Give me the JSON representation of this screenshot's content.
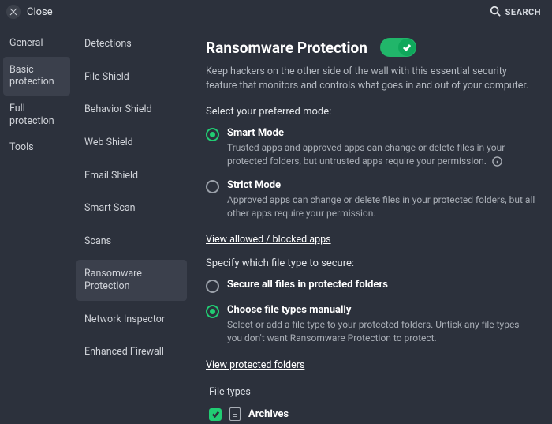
{
  "topbar": {
    "close_label": "Close",
    "search_label": "SEARCH"
  },
  "nav1": {
    "items": [
      {
        "label": "General"
      },
      {
        "label": "Basic protection"
      },
      {
        "label": "Full protection"
      },
      {
        "label": "Tools"
      }
    ],
    "active_index": 1
  },
  "nav2": {
    "items": [
      {
        "label": "Detections"
      },
      {
        "label": "File Shield"
      },
      {
        "label": "Behavior Shield"
      },
      {
        "label": "Web Shield"
      },
      {
        "label": "Email Shield"
      },
      {
        "label": "Smart Scan"
      },
      {
        "label": "Scans"
      },
      {
        "label": "Ransomware Protection"
      },
      {
        "label": "Network Inspector"
      },
      {
        "label": "Enhanced Firewall"
      }
    ],
    "active_index": 7
  },
  "main": {
    "title": "Ransomware Protection",
    "toggle_on": true,
    "description": "Keep hackers on the other side of the wall with this essential security feature that monitors and controls what goes in and out of your computer.",
    "mode_section_label": "Select your preferred mode:",
    "modes": [
      {
        "title": "Smart Mode",
        "desc": "Trusted apps and approved apps can change or delete files in your protected folders, but untrusted apps require your permission.",
        "has_info": true,
        "checked": true
      },
      {
        "title": "Strict Mode",
        "desc": "Approved apps can change or delete files in your protected folders, but all other apps require your permission.",
        "has_info": false,
        "checked": false
      }
    ],
    "link_allowed": "View allowed / blocked apps",
    "filetype_section_label": "Specify which file type to secure:",
    "filetype_options": [
      {
        "title": "Secure all files in protected folders",
        "desc": "",
        "checked": false
      },
      {
        "title": "Choose file types manually",
        "desc": "Select or add a file type to your protected folders. Untick any file types you don't want Ransomware Protection to protect.",
        "checked": true
      }
    ],
    "link_protected": "View protected folders",
    "filetypes_label": "File types",
    "filetypes": [
      {
        "name": "Archives",
        "checked": true
      }
    ]
  }
}
